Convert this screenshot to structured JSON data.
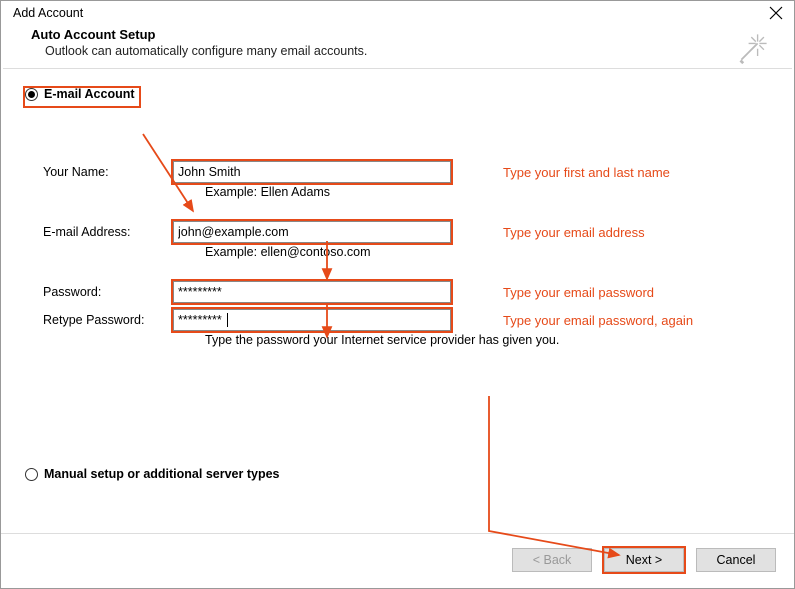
{
  "window": {
    "title": "Add Account"
  },
  "header": {
    "title": "Auto Account Setup",
    "subtitle": "Outlook can automatically configure many email accounts."
  },
  "options": {
    "email_account_label": "E-mail Account",
    "manual_label": "Manual setup or additional server types"
  },
  "form": {
    "name_label": "Your Name:",
    "name_value": "John Smith",
    "name_example": "Example: Ellen Adams",
    "email_label": "E-mail Address:",
    "email_value": "john@example.com",
    "email_example": "Example: ellen@contoso.com",
    "password_label": "Password:",
    "password_value": "*********",
    "retype_label": "Retype Password:",
    "retype_value": "*********",
    "password_note": "Type the password your Internet service provider has given you."
  },
  "annotations": {
    "name": "Type your first and last name",
    "email": "Type your email address",
    "password": "Type your email password",
    "retype": "Type your email password, again"
  },
  "buttons": {
    "back": "< Back",
    "next": "Next >",
    "cancel": "Cancel"
  },
  "colors": {
    "highlight": "#e64a19"
  }
}
